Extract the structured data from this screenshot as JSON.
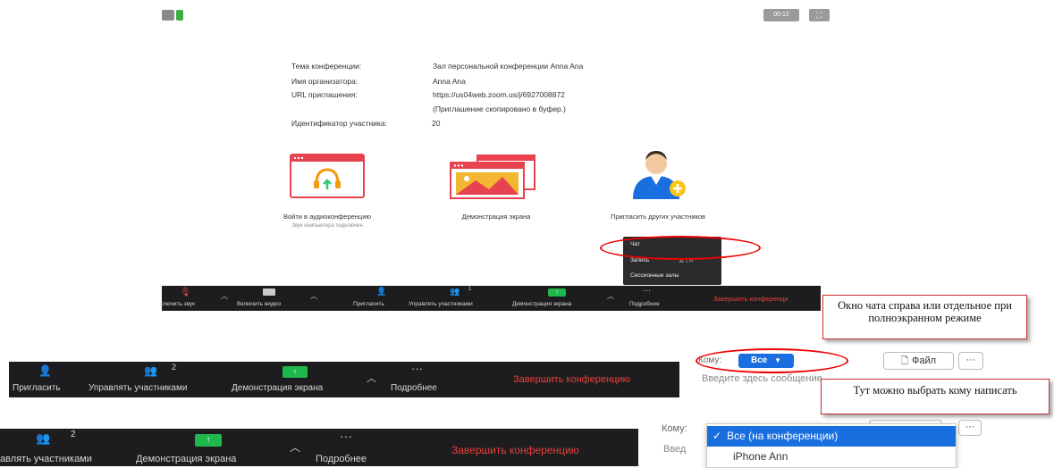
{
  "topbar": {
    "timer": "00:12"
  },
  "info": {
    "topic_label": "Тема конференции:",
    "topic_value": "Зал персональной конференции Anna Ana",
    "host_label": "Имя организатора:",
    "host_value": "Anna Ana",
    "url_label": "URL приглашения:",
    "url_value": "https://us04web.zoom.us/j/6927008872",
    "url_note": "(Приглашение скопировано в буфер.)",
    "participant_label": "Идентификатор участника:",
    "participant_value": "20"
  },
  "cards": {
    "audio_label": "Войти в аудиоконференцию",
    "audio_sub": "Звук компьютера подключен",
    "share_label": "Демонстрация экрана",
    "invite_label": "Пригласить других участников"
  },
  "menu": {
    "chat": "Чат",
    "record": "Запись",
    "record_key": "⌘⇧R",
    "rooms": "Сессионные залы"
  },
  "small_toolbar": {
    "mute": "ключить звук",
    "video": "Включить видео",
    "invite": "Пригласить",
    "manage": "Управлять участниками",
    "manage_count": "1",
    "share": "Демонстрация экрана",
    "more": "Подробнее",
    "end": "Завершить конференци"
  },
  "toolbar2": {
    "invite": "Пригласить",
    "manage": "Управлять участниками",
    "manage_count": "2",
    "share": "Демонстрация экрана",
    "more": "Подробнее",
    "end": "Завершить конференцию"
  },
  "toolbar3": {
    "manage": "авлять участниками",
    "manage_count": "2",
    "share": "Демонстрация экрана",
    "more": "Подробнее",
    "end": "Завершить конференцию"
  },
  "notes": {
    "chat_window": "Окно чата справа или отдельное при полноэкранном режиме",
    "choose_recipient": "Тут можно выбрать кому написать"
  },
  "chat": {
    "to_label": "Кому:",
    "to_label_clipped": "Кому:",
    "recipient": "Все",
    "file_button": "Файл",
    "more_button": "···",
    "input_placeholder": "Введите здесь сообщение",
    "input_placeholder_clipped": "Введ"
  },
  "dropdown": {
    "options": [
      "Все (на конференции)",
      "iPhone Ann"
    ]
  },
  "colors": {
    "accent": "#1a6fe0",
    "end_red": "#e8403a",
    "share_green": "#1fb84a",
    "annotation_red": "#e00000"
  }
}
